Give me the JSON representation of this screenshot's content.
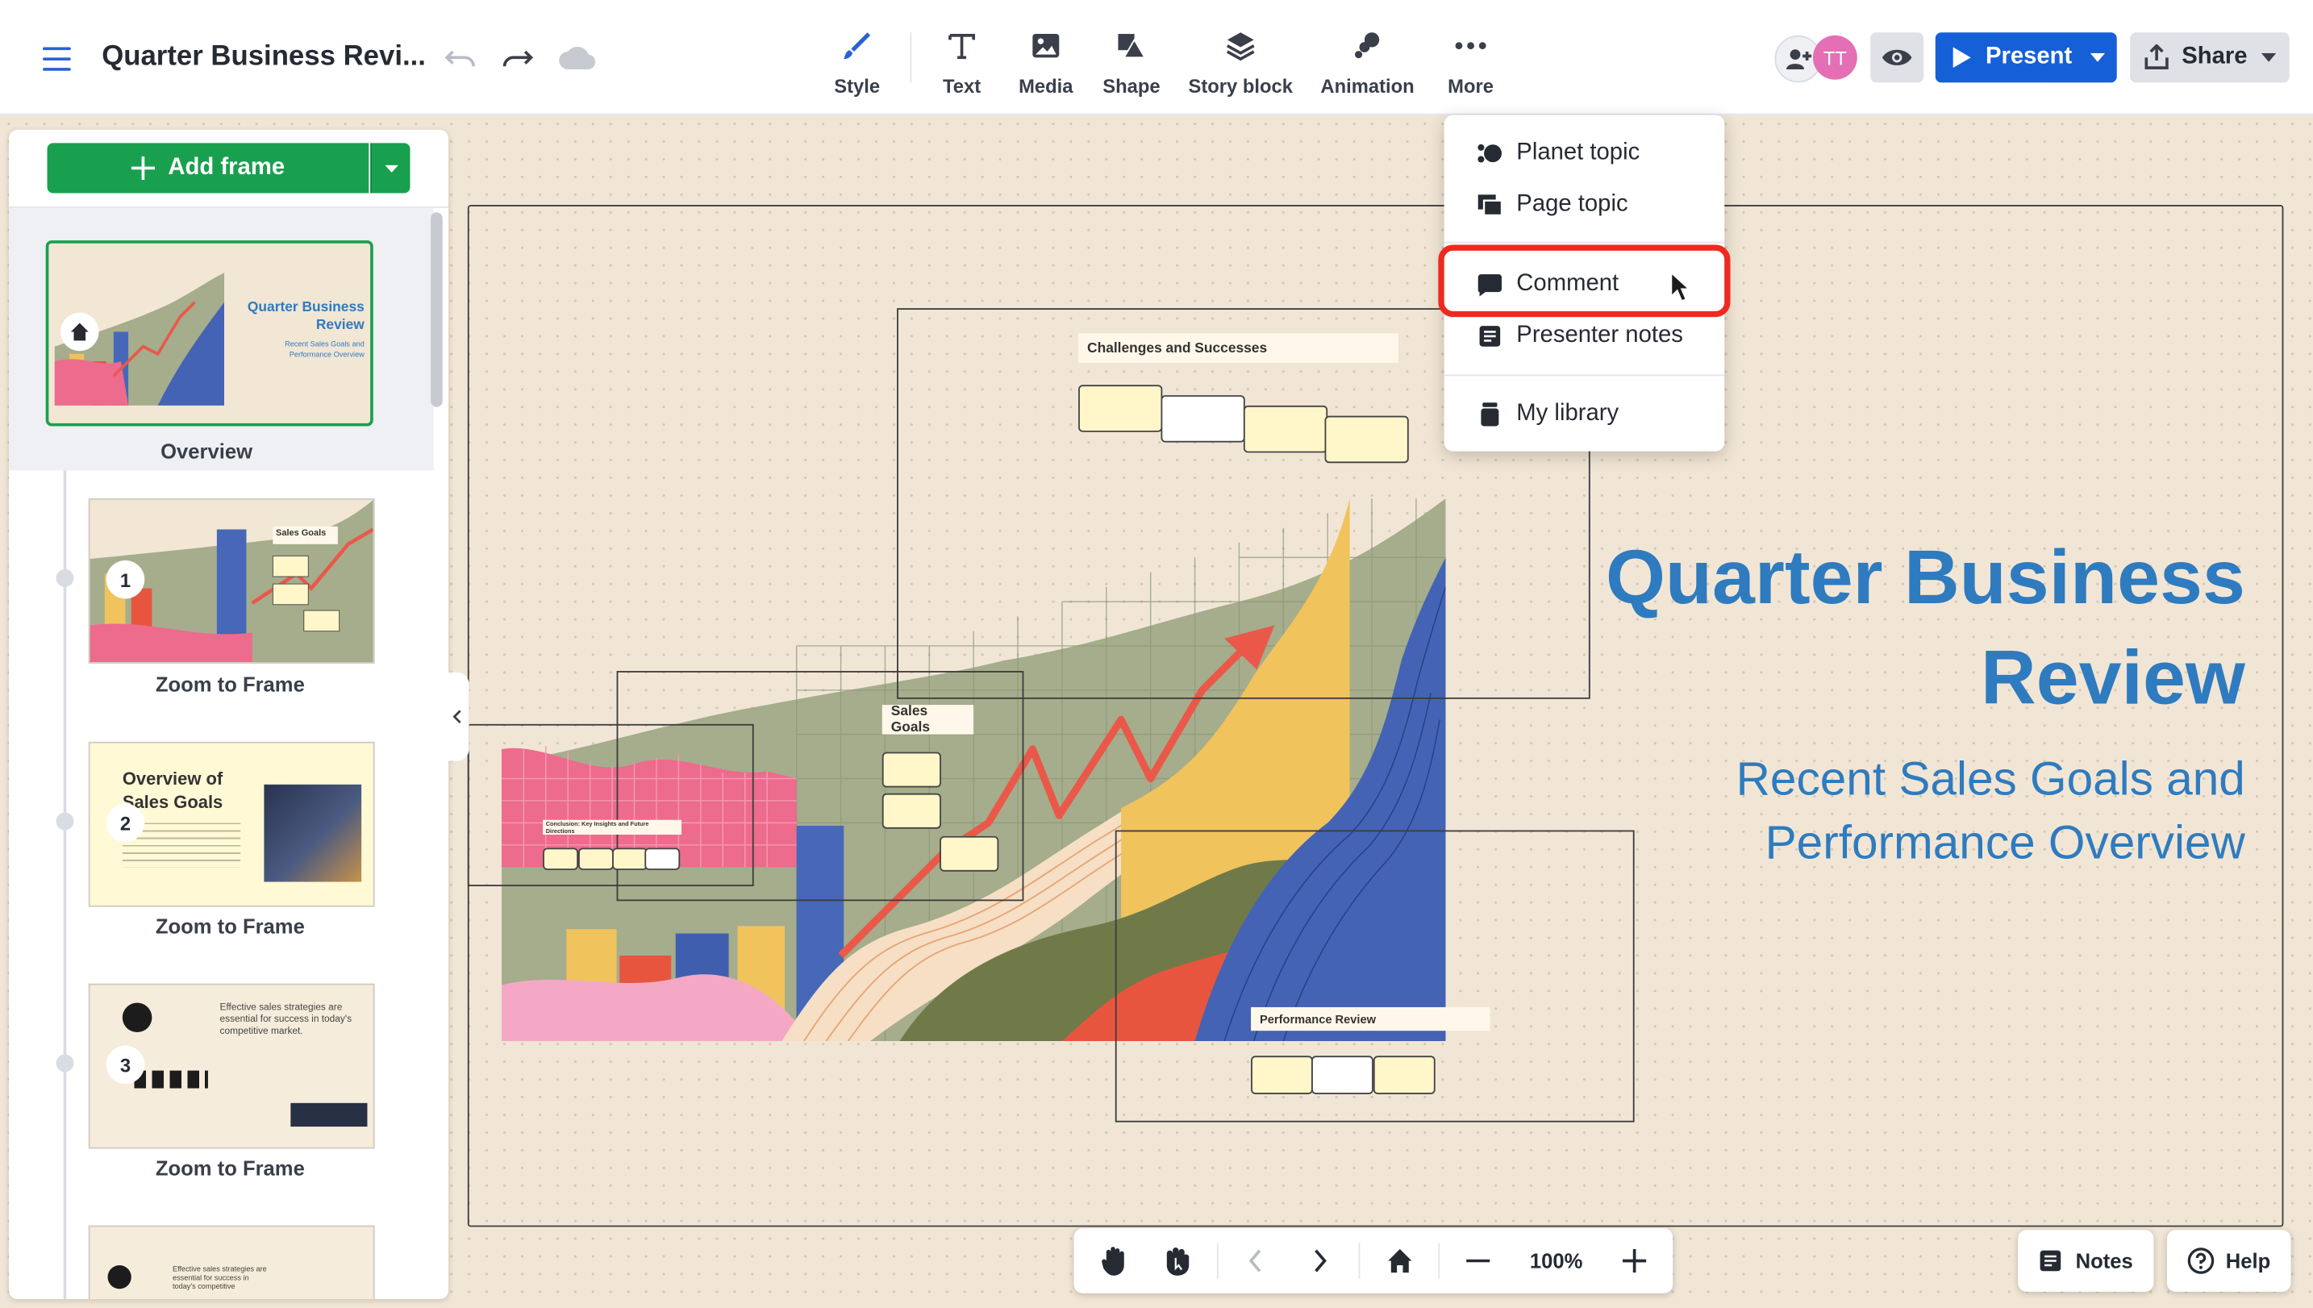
{
  "header": {
    "title": "Quarter Business Revi...",
    "tools": [
      {
        "label": "Style",
        "icon": "brush-icon"
      },
      {
        "label": "Text",
        "icon": "text-icon"
      },
      {
        "label": "Media",
        "icon": "image-icon"
      },
      {
        "label": "Shape",
        "icon": "shape-icon"
      },
      {
        "label": "Story block",
        "icon": "layers-icon"
      },
      {
        "label": "Animation",
        "icon": "animation-icon"
      },
      {
        "label": "More",
        "icon": "more-icon"
      }
    ],
    "avatar_initials": "TT",
    "present_label": "Present",
    "share_label": "Share"
  },
  "sidebar": {
    "add_frame_label": "Add frame",
    "items": [
      {
        "label": "Overview"
      },
      {
        "number": "1",
        "label": "Zoom to Frame"
      },
      {
        "number": "2",
        "label": "Zoom to Frame"
      },
      {
        "number": "3",
        "label": "Zoom to Frame"
      }
    ],
    "thumb_texts": {
      "overview_title": "Quarter Business Review",
      "overview_sub": "Recent Sales Goals and Performance Overview",
      "t1_label": "Sales Goals",
      "t2_title": "Overview of Sales Goals",
      "t3_text": "Effective sales strategies are essential for success in today's competitive market.",
      "t4_text": "Effective sales strategies are essential for success in today's competitive"
    }
  },
  "canvas": {
    "title_line1": "Quarter Business",
    "title_line2": "Review",
    "subtitle_line1": "Recent Sales Goals and",
    "subtitle_line2": "Performance Overview",
    "labels": {
      "challenges": "Challenges and Successes",
      "sales_goals": "Sales Goals",
      "performance": "Performance Review",
      "conclusion": "Conclusion: Key Insights and Future Directions"
    },
    "colors": {
      "title": "#2f7bbf",
      "arrow": "#ea5849"
    }
  },
  "more_menu": {
    "items": [
      {
        "label": "Planet topic",
        "icon": "planet-topic-icon"
      },
      {
        "label": "Page topic",
        "icon": "page-topic-icon"
      },
      {
        "label": "Comment",
        "icon": "comment-icon"
      },
      {
        "label": "Presenter notes",
        "icon": "presenter-notes-icon"
      },
      {
        "label": "My library",
        "icon": "library-icon"
      }
    ]
  },
  "bottom": {
    "zoom": "100%",
    "notes_label": "Notes",
    "help_label": "Help"
  }
}
